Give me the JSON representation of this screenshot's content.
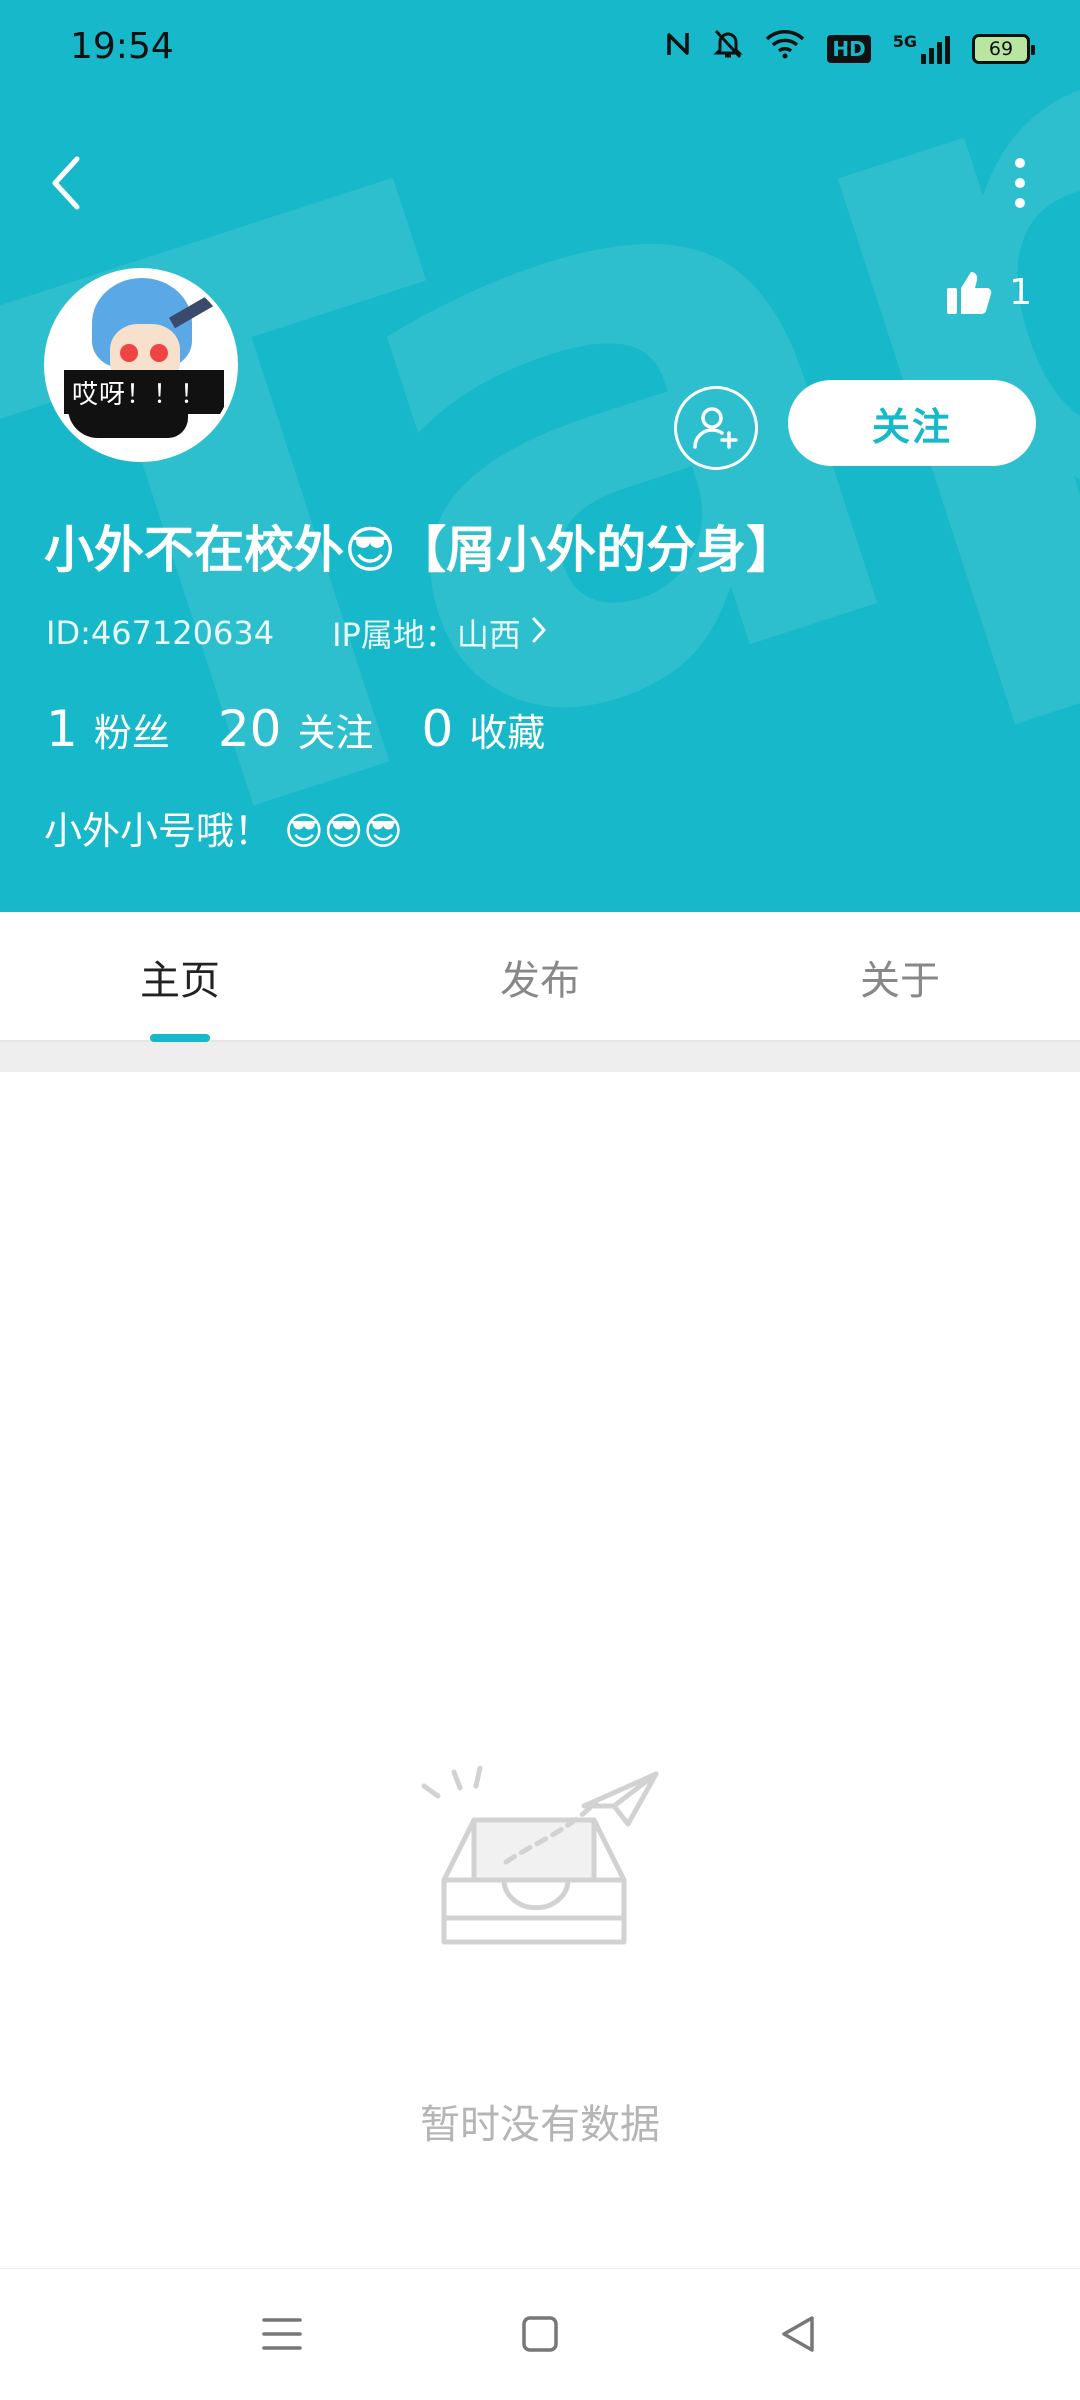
{
  "status_bar": {
    "time": "19:54",
    "icons": [
      "nfc-icon",
      "mute-bell-icon",
      "wifi-icon",
      "hd-icon",
      "5g-signal-icon",
      "battery-icon"
    ],
    "hd_label": "HD",
    "network_label": "5G",
    "battery_level": "69"
  },
  "header": {
    "background_color": "#16b8c9",
    "likes_count": "1",
    "follow_label": "关注",
    "avatar_caption": "哎呀！！！"
  },
  "profile": {
    "username": "小外不在校外😎【屑小外的分身】",
    "id_text": "ID:467120634",
    "ip_text": "IP属地：山西",
    "stats": [
      {
        "value": "1",
        "label": "粉丝"
      },
      {
        "value": "20",
        "label": "关注"
      },
      {
        "value": "0",
        "label": "收藏"
      }
    ],
    "bio": "小外小号哦！ 😎😎😎"
  },
  "tabs": [
    {
      "label": "主页",
      "active": true
    },
    {
      "label": "发布",
      "active": false
    },
    {
      "label": "关于",
      "active": false
    }
  ],
  "empty_state": {
    "message": "暂时没有数据"
  },
  "colors": {
    "accent": "#16b8c9",
    "tab_inactive": "#888888",
    "empty_text": "#b5b5b5"
  }
}
